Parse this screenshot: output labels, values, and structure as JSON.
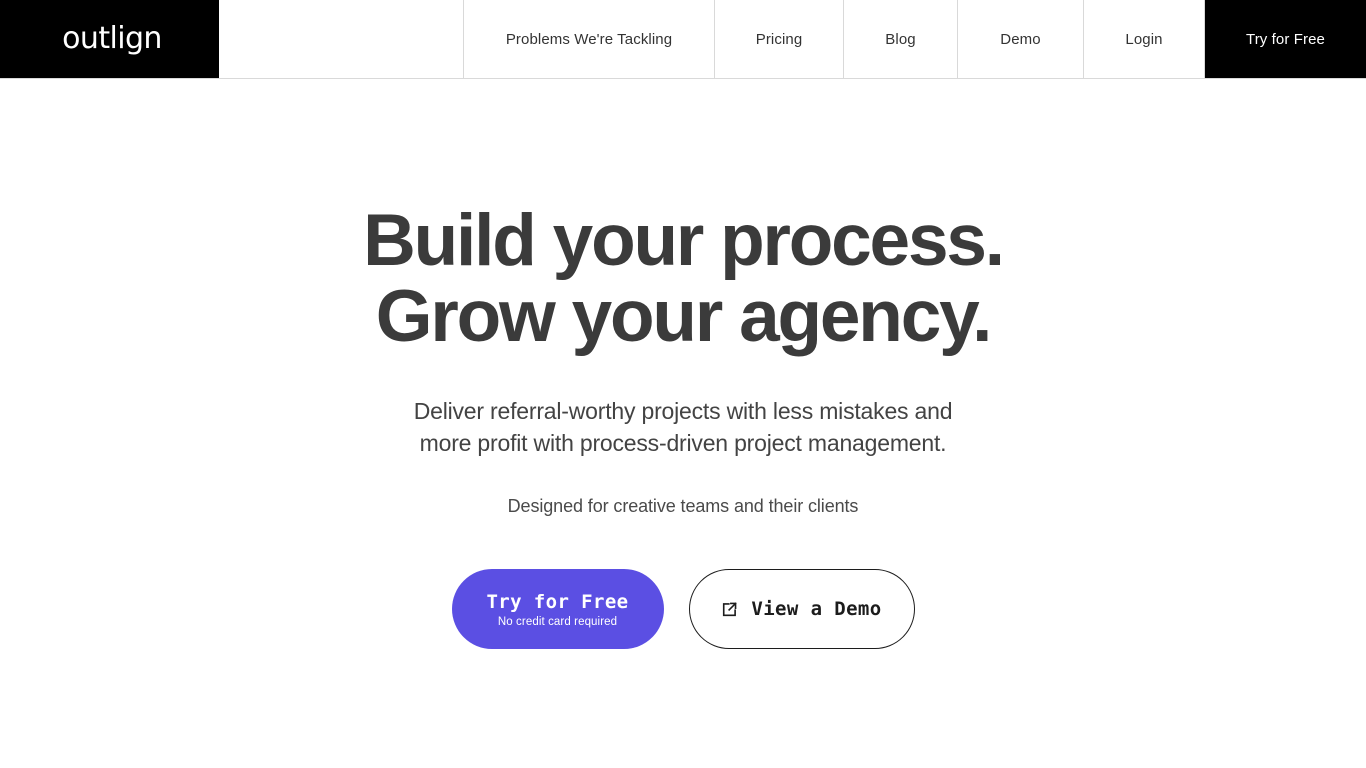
{
  "brand": {
    "logo_text": "outlign",
    "accent_color": "#5b4fe3",
    "nav_bg_color": "#000000",
    "headline_color": "#3b3b3b"
  },
  "nav": {
    "items": [
      {
        "label": "Problems We're Tackling"
      },
      {
        "label": "Pricing"
      },
      {
        "label": "Blog"
      },
      {
        "label": "Demo"
      },
      {
        "label": "Login"
      }
    ],
    "cta_label": "Try for Free"
  },
  "hero": {
    "headline_line_1": "Build your process.",
    "headline_line_2": "Grow your agency.",
    "subhead_line_1": "Deliver referral-worthy projects with less mistakes and",
    "subhead_line_2": "more profit with process-driven project management.",
    "tagline": "Designed for creative teams and their clients",
    "primary_button": {
      "label": "Try for Free",
      "sublabel": "No credit card required"
    },
    "secondary_button": {
      "label": "View a Demo",
      "icon": "external-link-icon"
    }
  }
}
